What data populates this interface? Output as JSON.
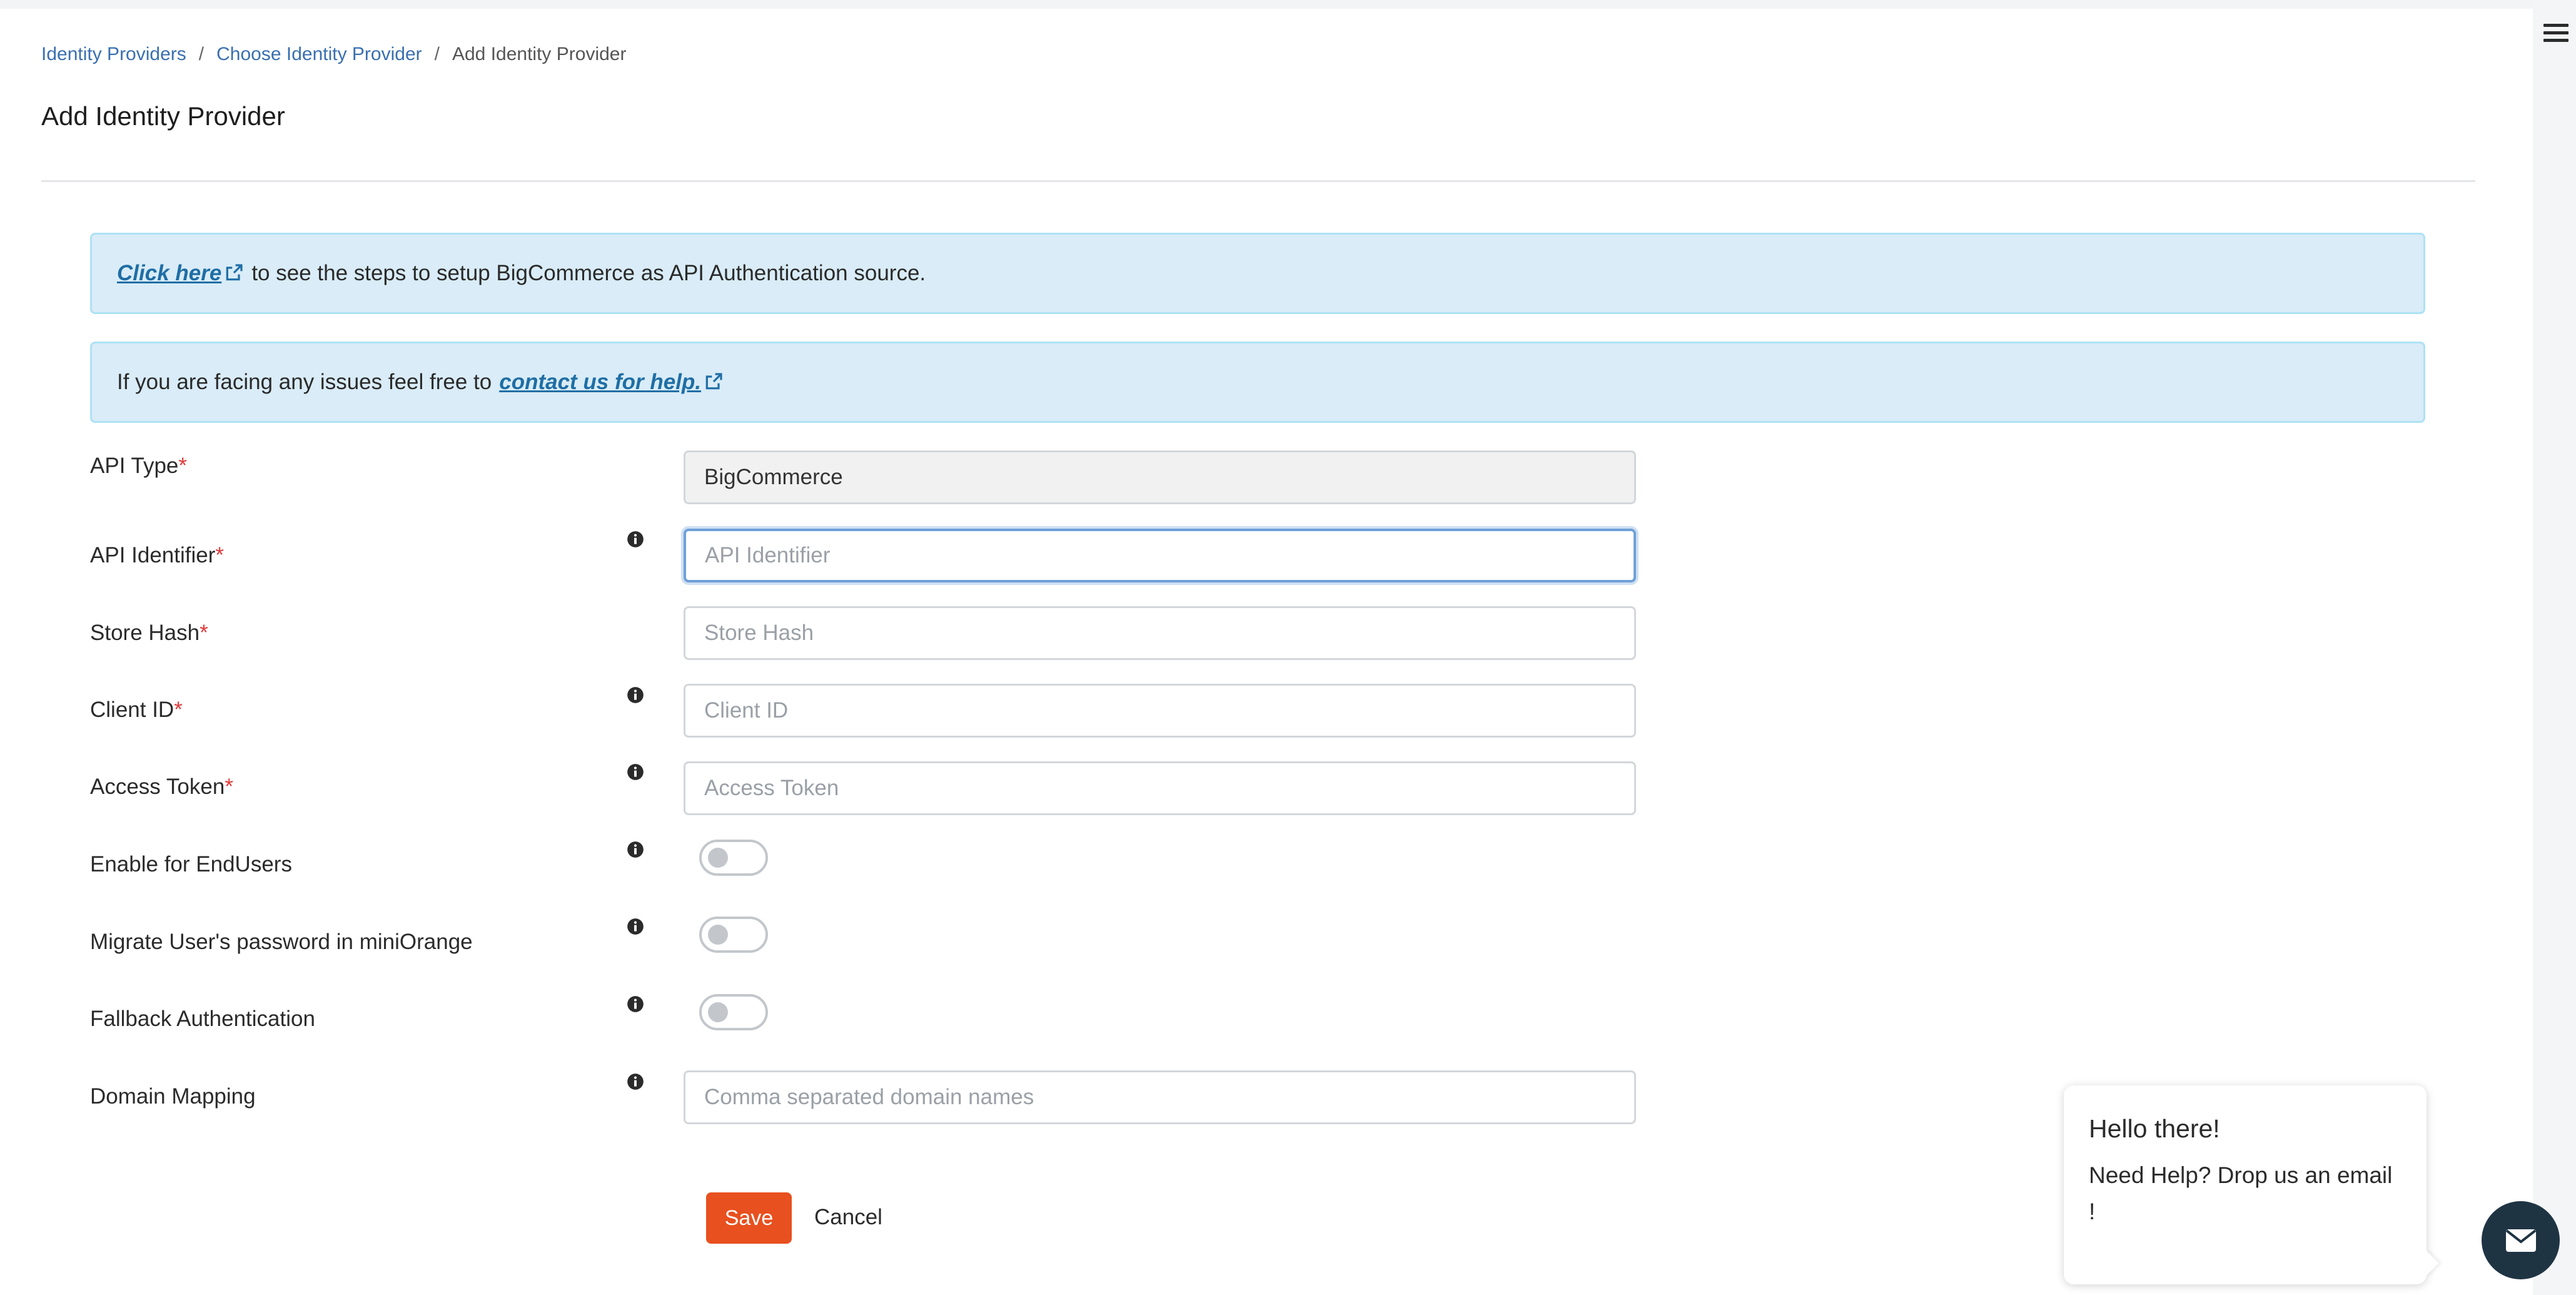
{
  "breadcrumb": {
    "items": [
      "Identity Providers",
      "Choose Identity Provider",
      "Add Identity Provider"
    ],
    "separator": "/"
  },
  "page": {
    "title": "Add Identity Provider"
  },
  "alerts": {
    "setup": {
      "link_text": "Click here",
      "text": "to see the steps to setup BigCommerce as API Authentication source."
    },
    "help": {
      "text": "If you are facing any issues feel free to",
      "link_text": "contact us for help."
    }
  },
  "form": {
    "required_mark": "*",
    "api_type": {
      "label": "API Type",
      "value": "BigCommerce"
    },
    "api_identifier": {
      "label": "API Identifier",
      "placeholder": "API Identifier",
      "value": ""
    },
    "store_hash": {
      "label": "Store Hash",
      "placeholder": "Store Hash",
      "value": ""
    },
    "client_id": {
      "label": "Client ID",
      "placeholder": "Client ID",
      "value": ""
    },
    "access_token": {
      "label": "Access Token",
      "placeholder": "Access Token",
      "value": ""
    },
    "enable_endusers": {
      "label": "Enable for EndUsers",
      "enabled": false
    },
    "migrate_password": {
      "label": "Migrate User's password in miniOrange",
      "enabled": false
    },
    "fallback_auth": {
      "label": "Fallback Authentication",
      "enabled": false
    },
    "domain_mapping": {
      "label": "Domain Mapping",
      "placeholder": "Comma separated domain names",
      "value": ""
    }
  },
  "actions": {
    "save_label": "Save",
    "cancel_label": "Cancel"
  },
  "chat": {
    "title": "Hello there!",
    "body": "Need Help? Drop us an email !"
  },
  "colors": {
    "accent": "#e8501f",
    "link": "#1f6ea5",
    "alert_bg": "#d9ecf7",
    "chat_button": "#1f3443",
    "required": "#e03a3a"
  }
}
